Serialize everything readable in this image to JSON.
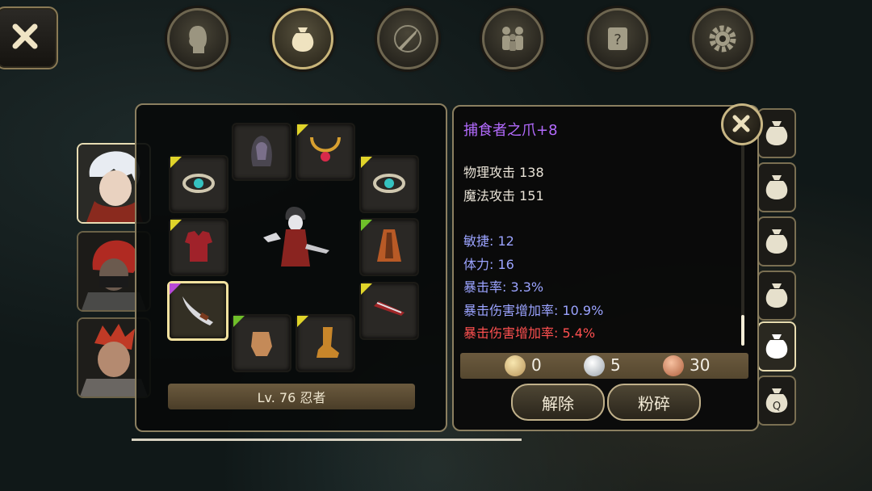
{
  "top_tabs": [
    {
      "name": "character"
    },
    {
      "name": "inventory",
      "active": true
    },
    {
      "name": "skills"
    },
    {
      "name": "party"
    },
    {
      "name": "quest"
    },
    {
      "name": "settings"
    }
  ],
  "character": {
    "level_label": "Lv. 76 忍者"
  },
  "item": {
    "name": "捕食者之爪+8",
    "base_stats": [
      "物理攻击 138",
      "魔法攻击 151"
    ],
    "bonus_stats": [
      "敏捷: 12",
      "体力: 16",
      "暴击率: 3.3%",
      "暴击伤害增加率: 10.9%"
    ],
    "special_stat": "暴击伤害增加率: 5.4%"
  },
  "currency": {
    "gold": "0",
    "silver": "5",
    "copper": "30"
  },
  "buttons": {
    "unequip": "解除",
    "smash": "粉碎"
  },
  "colors": {
    "item_name": "#b46bff",
    "bonus_stat": "#9ba3ff",
    "special_stat": "#ff5050",
    "frame": "#8b7f60"
  }
}
